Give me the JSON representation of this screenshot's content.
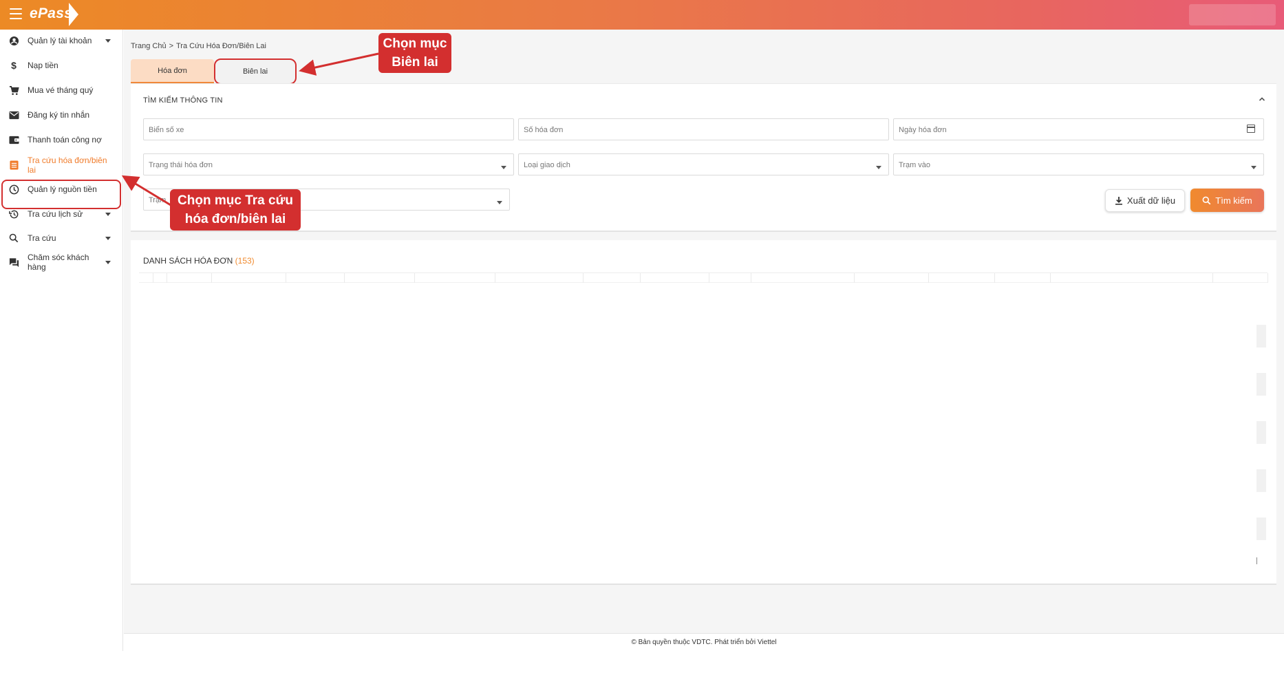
{
  "app": {
    "logo": "ePass"
  },
  "sidebar": {
    "items": [
      {
        "label": "Quản lý tài khoản",
        "icon": "account-circle-icon",
        "has_caret": true
      },
      {
        "label": "Nạp tiền",
        "icon": "dollar-icon",
        "has_caret": false
      },
      {
        "label": "Mua vé tháng quý",
        "icon": "cart-icon",
        "has_caret": false
      },
      {
        "label": "Đăng ký tin nhắn",
        "icon": "mail-icon",
        "has_caret": false
      },
      {
        "label": "Thanh toán công nợ",
        "icon": "wallet-icon",
        "has_caret": false
      },
      {
        "label": "Tra cứu hóa đơn/biên lai",
        "icon": "receipt-icon",
        "has_caret": false,
        "active": true
      },
      {
        "label": "Quản lý nguồn tiền",
        "icon": "clock-icon",
        "has_caret": false
      },
      {
        "label": "Tra cứu lịch sử",
        "icon": "history-icon",
        "has_caret": true
      },
      {
        "label": "Tra cứu",
        "icon": "search-icon",
        "has_caret": true
      },
      {
        "label": "Chăm sóc khách hàng",
        "icon": "chat-icon",
        "has_caret": true
      }
    ]
  },
  "breadcrumb": {
    "home": "Trang Chủ",
    "separator": ">",
    "current": "Tra Cứu Hóa Đơn/Biên Lai"
  },
  "tabs": [
    {
      "label": "Hóa đơn",
      "active": true
    },
    {
      "label": "Biên lai",
      "active": false
    }
  ],
  "search": {
    "title": "TÌM KIẾM THÔNG TIN",
    "fields": {
      "plate": "Biển số xe",
      "invoice_no": "Số hóa đơn",
      "invoice_date": "Ngày hóa đơn",
      "invoice_status": "Trạng thái hóa đơn",
      "transaction_type": "Loại giao dịch",
      "entry_station": "Trạm vào",
      "station": "Trạm"
    },
    "export_label": "Xuất dữ liệu",
    "search_label": "Tìm kiếm"
  },
  "list": {
    "title": "DANH SÁCH HÓA ĐƠN",
    "count": "(153)"
  },
  "footer": {
    "text": "© Bản quyền thuộc VDTC. Phát triển bởi Viettel"
  },
  "annotations": {
    "callout_tab": [
      "Chọn mục",
      "Biên lai"
    ],
    "callout_menu": [
      "Chọn mục Tra cứu",
      "hóa đơn/biên lai"
    ]
  },
  "colors": {
    "accent": "#f08a2e",
    "annotation": "#d32f2f",
    "header_start": "#ec8a25",
    "header_end": "#e85b78"
  }
}
